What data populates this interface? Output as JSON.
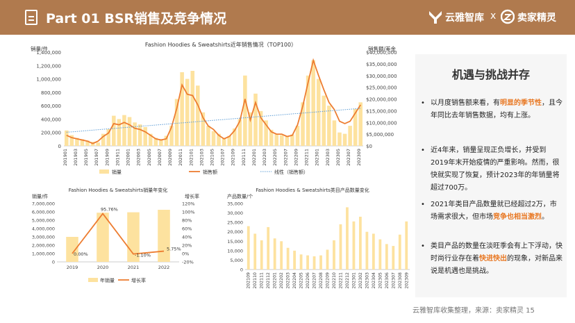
{
  "header": {
    "title": "Part 01  BSR销售及竞争情况",
    "brand_left": "云雅智库",
    "brand_x": "x",
    "brand_right": "卖家精灵"
  },
  "colors": {
    "header_bg": "#b07a4e",
    "bar": "#fde29f",
    "line": "#ed7d31",
    "trend": "#5b9bd5",
    "highlight": "#e87722"
  },
  "chart_data": [
    {
      "type": "bar",
      "title": "Fashion Hoodies & Sweatshirts近年销售情况（TOP100）",
      "ylabel": "销量/件",
      "y2label": "销售额/美金",
      "ylim": [
        0,
        1400000
      ],
      "y2lim": [
        0,
        40000000
      ],
      "yticks": [
        "0",
        "200,000",
        "400,000",
        "600,000",
        "800,000",
        "1,000,000",
        "1,200,000",
        "1,400,000"
      ],
      "y2ticks": [
        "$0",
        "$5,000,000",
        "$10,000,000",
        "$15,000,000",
        "$20,000,000",
        "$25,000,000",
        "$30,000,000",
        "$35,000,000",
        "$40,000,000"
      ],
      "xtick_labels": [
        "201901",
        "201903",
        "201905",
        "201907",
        "201909",
        "201911",
        "202001",
        "202003",
        "202005",
        "202007",
        "202009",
        "202011",
        "202101",
        "202103",
        "202105",
        "202107",
        "202109",
        "202111",
        "202201",
        "202203",
        "202205",
        "202207",
        "202209",
        "202211",
        "202301",
        "202303",
        "202305",
        "202307",
        "202309"
      ],
      "categories": [
        "201901",
        "201902",
        "201903",
        "201904",
        "201905",
        "201906",
        "201907",
        "201908",
        "201909",
        "201910",
        "201911",
        "201912",
        "202001",
        "202002",
        "202003",
        "202004",
        "202005",
        "202006",
        "202007",
        "202008",
        "202009",
        "202010",
        "202011",
        "202012",
        "202101",
        "202102",
        "202103",
        "202104",
        "202105",
        "202106",
        "202107",
        "202108",
        "202109",
        "202110",
        "202111",
        "202112",
        "202201",
        "202202",
        "202203",
        "202204",
        "202205",
        "202206",
        "202207",
        "202208",
        "202209",
        "202210",
        "202211",
        "202212",
        "202301",
        "202302",
        "202303",
        "202304",
        "202305",
        "202306",
        "202307",
        "202308",
        "202309"
      ],
      "series": [
        {
          "name": "销量",
          "kind": "bar",
          "values": [
            230000,
            160000,
            120000,
            100000,
            80000,
            60000,
            50000,
            180000,
            250000,
            450000,
            400000,
            460000,
            430000,
            350000,
            320000,
            280000,
            180000,
            120000,
            100000,
            150000,
            300000,
            700000,
            1100000,
            1000000,
            1120000,
            900000,
            500000,
            300000,
            220000,
            180000,
            120000,
            150000,
            260000,
            400000,
            1050000,
            500000,
            780000,
            520000,
            380000,
            240000,
            180000,
            160000,
            140000,
            170000,
            300000,
            650000,
            1050000,
            1280000,
            1000000,
            750000,
            600000,
            380000,
            200000,
            180000,
            300000,
            550000,
            650000
          ]
        },
        {
          "name": "销售额",
          "kind": "line",
          "values": [
            4500000,
            3500000,
            3000000,
            2500000,
            2000000,
            1000000,
            2000000,
            4000000,
            5500000,
            9500000,
            9000000,
            10000000,
            9000000,
            7500000,
            7000000,
            6000000,
            4500000,
            3000000,
            2500000,
            3000000,
            8000000,
            16000000,
            26000000,
            22000000,
            21500000,
            17500000,
            12000000,
            8500000,
            7000000,
            4500000,
            3000000,
            4000000,
            6500000,
            10500000,
            20000000,
            11000000,
            18500000,
            12000000,
            9000000,
            6000000,
            5000000,
            5000000,
            4000000,
            4500000,
            9000000,
            17000000,
            27000000,
            36500000,
            30000000,
            24000000,
            18500000,
            15500000,
            10500000,
            9500000,
            10500000,
            14000000,
            17500000
          ]
        },
        {
          "name": "线性（销售额）",
          "kind": "trend",
          "start": 5800000,
          "end": 16000000
        }
      ],
      "legend": [
        "销量",
        "销售额",
        "线性（销售额）"
      ]
    },
    {
      "type": "bar",
      "title": "Fashion Hoodies & Sweatshirts销量年变化",
      "ylabel": "销量/件",
      "y2label": "增长率",
      "categories": [
        "2019",
        "2020",
        "2021",
        "2022"
      ],
      "ylim": [
        0,
        7000000
      ],
      "y2lim": [
        -20,
        120
      ],
      "yticks": [
        "0",
        "1,000,000",
        "2,000,000",
        "3,000,000",
        "4,000,000",
        "5,000,000",
        "6,000,000",
        "7,000,000"
      ],
      "y2ticks": [
        "-20%",
        "0%",
        "20%",
        "40%",
        "60%",
        "80%",
        "100%",
        "120%"
      ],
      "series": [
        {
          "name": "年销量",
          "kind": "bar",
          "values": [
            3000000,
            5900000,
            5950000,
            6250000
          ]
        },
        {
          "name": "增长率",
          "kind": "line",
          "values": [
            0,
            95.76,
            -1.1,
            5.75
          ],
          "labels": [
            "0.00%",
            "95.76%",
            "-1.10%",
            "5.75%"
          ]
        }
      ],
      "legend": [
        "年销量",
        "增长率"
      ]
    },
    {
      "type": "bar",
      "title": "Fashion Hoodies & Sweatshirts类目产品数量变化",
      "ylabel": "产品数量/个",
      "ylim": [
        0,
        35000
      ],
      "yticks": [
        "0",
        "5,000",
        "10,000",
        "15,000",
        "20,000",
        "25,000",
        "30,000",
        "35,000"
      ],
      "categories": [
        "202109",
        "202110",
        "202111",
        "202112",
        "202201",
        "202202",
        "202203",
        "202204",
        "202205",
        "202206",
        "202207",
        "202208",
        "202209",
        "202210",
        "202211",
        "202212",
        "202301",
        "202302",
        "202303",
        "202304",
        "202305",
        "202306",
        "202307",
        "202308",
        "202309"
      ],
      "xtick_labels": [
        "202109",
        "202110",
        "202111",
        "202112",
        "202201",
        "202202",
        "202203",
        "202204",
        "202205",
        "202206",
        "202207",
        "202208",
        "202209",
        "202210",
        "202211",
        "202212",
        "202301",
        "202302",
        "202303",
        "202304",
        "202305",
        "202306",
        "202307",
        "202308",
        "202309"
      ],
      "series": [
        {
          "name": "产品数量",
          "kind": "bar",
          "values": [
            23000,
            19000,
            15500,
            22500,
            16500,
            15000,
            11500,
            10000,
            8000,
            7500,
            7000,
            7500,
            10500,
            15500,
            24000,
            33000,
            25500,
            28000,
            20000,
            19000,
            16000,
            13500,
            12500,
            18500,
            25500
          ]
        }
      ]
    }
  ],
  "panel": {
    "title": "机遇与挑战并存",
    "bullets": [
      {
        "dot": "•",
        "parts": [
          {
            "t": "以月度销售额来看，有",
            "hl": false
          },
          {
            "t": "明显的季节性",
            "hl": true
          },
          {
            "t": "，且今年同比去年销售数据，均有上涨。",
            "hl": false
          }
        ]
      },
      {
        "dot": "•",
        "parts": [
          {
            "t": "近4年来，销量呈现正负增长，并受到2019年末开始疫情的严重影响。然而，很快就实现了恢复，预计2023年的年销量将超过700万。",
            "hl": false
          }
        ]
      },
      {
        "dot": "•",
        "parts": [
          {
            "t": "2021年类目产品数量就已经超过2万，市场需求很大，但市场",
            "hl": false
          },
          {
            "t": "竞争也相当激烈",
            "hl": true
          },
          {
            "t": "。",
            "hl": false
          }
        ]
      },
      {
        "dot": "•",
        "parts": [
          {
            "t": "类目产品的数量在淡旺季会有上下浮动，快时尚行业存在着",
            "hl": false
          },
          {
            "t": "快进快出",
            "hl": true
          },
          {
            "t": "的现象，对新品来说是机遇也是挑战。",
            "hl": false
          }
        ]
      }
    ]
  },
  "footer": {
    "text": "云雅智库收集整理，来源：卖家精灵    15"
  }
}
